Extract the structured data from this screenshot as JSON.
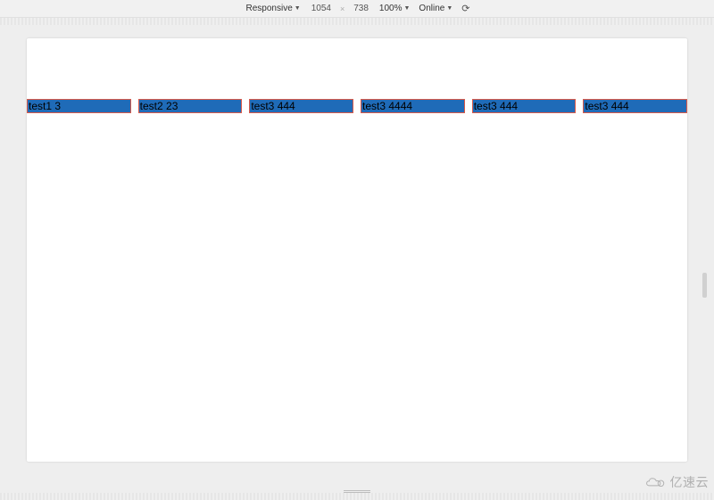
{
  "toolbar": {
    "device_label": "Responsive",
    "width": "1054",
    "height": "738",
    "zoom": "100%",
    "network": "Online"
  },
  "items": [
    {
      "label": "test1 3"
    },
    {
      "label": "test2 23"
    },
    {
      "label": "test3 444"
    },
    {
      "label": "test3 4444"
    },
    {
      "label": "test3 444"
    },
    {
      "label": "test3 444"
    }
  ],
  "watermark": {
    "text": "亿速云"
  }
}
